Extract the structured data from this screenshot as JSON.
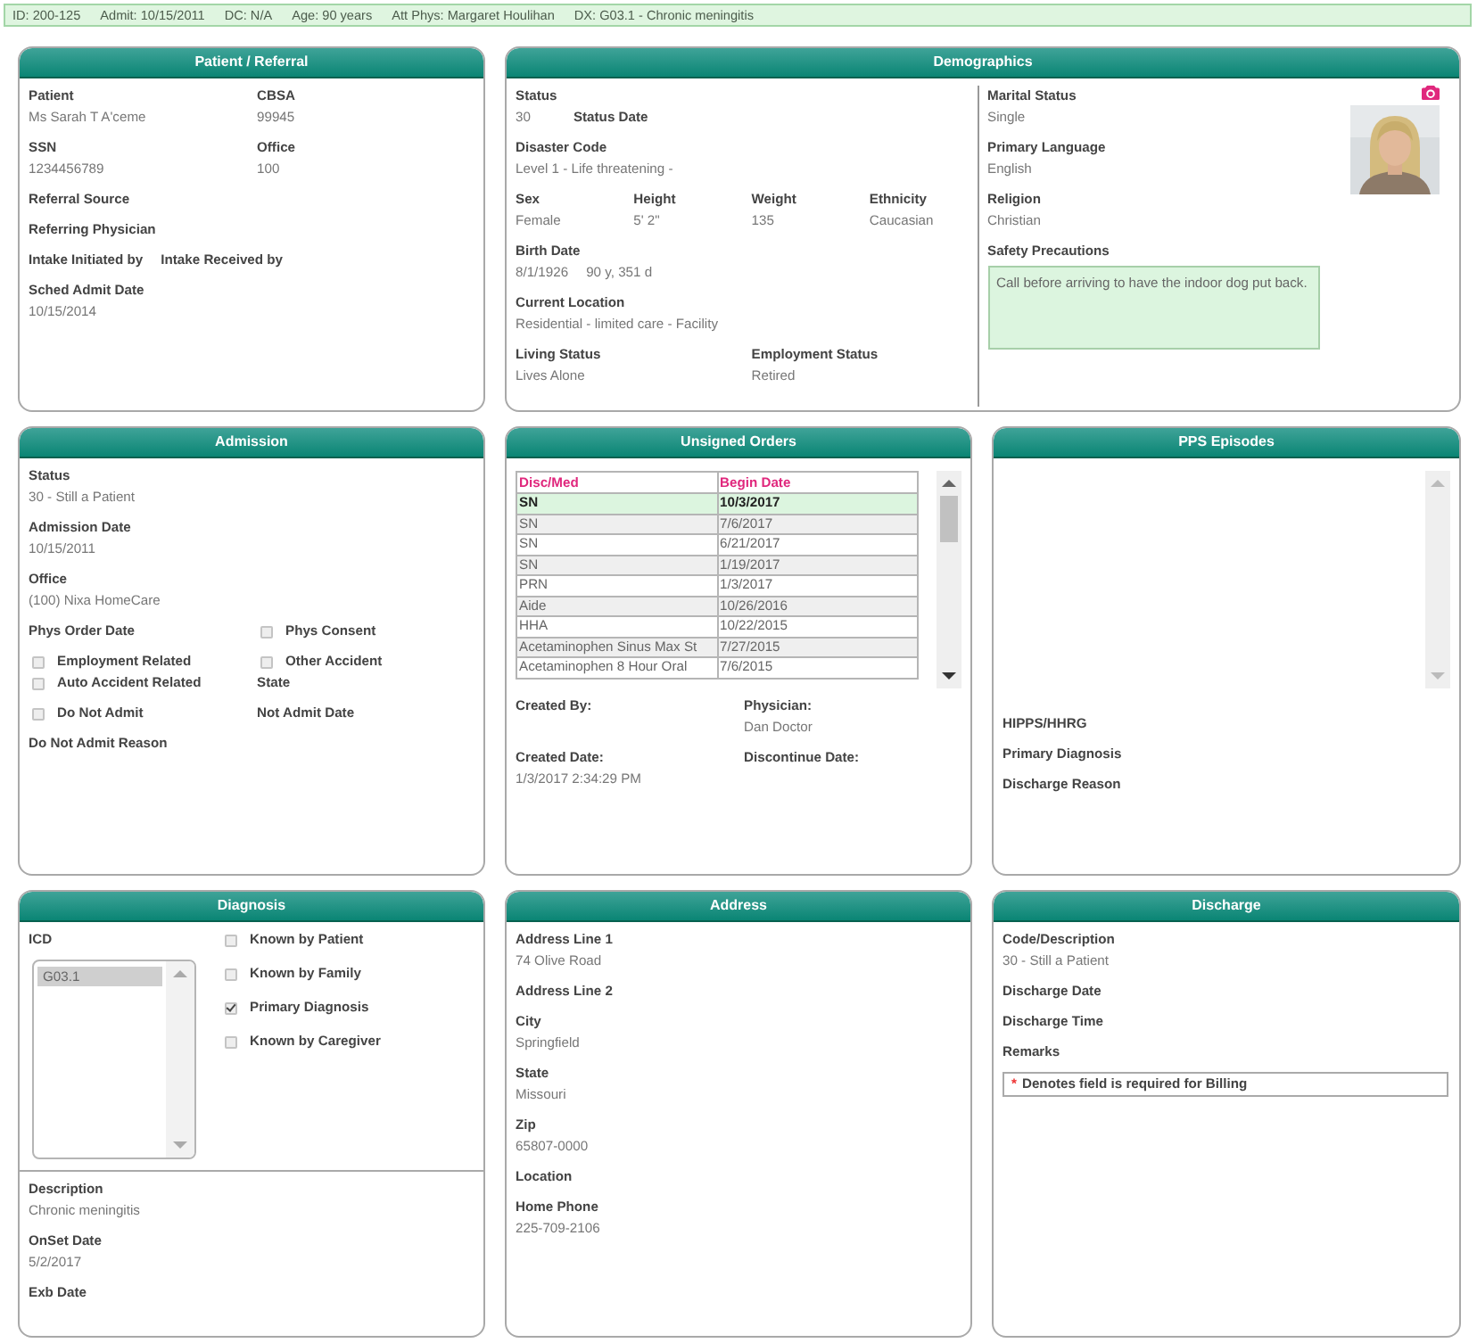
{
  "info_bar": {
    "items": [
      "ID: 200-125",
      "Admit: 10/15/2011",
      "DC: N/A",
      "Age: 90 years",
      "Att Phys: Margaret Houlihan",
      "DX: G03.1 - Chronic meningitis"
    ]
  },
  "panels": [
    {
      "kind": "standard",
      "title": "Patient / Referral",
      "sections": [
        {
          "kind": "rows",
          "rows": [
            {
              "kind": "grid",
              "cells": [
                {
                  "kind": "field",
                  "label": "Patient",
                  "value": "Ms Sarah T A'ceme"
                },
                {
                  "kind": "field",
                  "label": "CBSA",
                  "value": "99945"
                }
              ]
            },
            {
              "kind": "grid",
              "cells": [
                {
                  "kind": "field",
                  "label": "SSN",
                  "value": "1234456789"
                },
                {
                  "kind": "field",
                  "label": "Office",
                  "value": "100"
                }
              ]
            },
            {
              "kind": "grid",
              "cells": [
                {
                  "kind": "field",
                  "label": "Referral Source"
                }
              ]
            },
            {
              "kind": "grid",
              "cells": [
                {
                  "kind": "field",
                  "label": "Referring Physician"
                }
              ]
            },
            {
              "kind": "inline",
              "cells": [
                {
                  "kind": "field",
                  "label": "Intake Initiated by"
                },
                {
                  "kind": "field",
                  "label": "Intake Received by"
                }
              ]
            },
            {
              "kind": "grid",
              "cells": [
                {
                  "kind": "field",
                  "label": "Sched Admit Date",
                  "value": "10/15/2014"
                }
              ]
            }
          ]
        }
      ]
    },
    {
      "kind": "wide",
      "title": "Demographics",
      "sections": [
        {
          "kind": "columns",
          "left": [
            {
              "kind": "rows",
              "rows": [
                {
                  "kind": "grid",
                  "cells": [
                    {
                      "kind": "field",
                      "label": "Status",
                      "value": "30",
                      "side_label": "Status Date"
                    }
                  ]
                },
                {
                  "kind": "grid",
                  "cells": [
                    {
                      "kind": "field",
                      "label": "Disaster Code",
                      "value": "Level 1 - Life threatening -"
                    }
                  ]
                },
                {
                  "kind": "grid",
                  "cells": [
                    {
                      "kind": "field",
                      "label": "Sex",
                      "value": "Female"
                    },
                    {
                      "kind": "field",
                      "label": "Height",
                      "value": "5' 2\""
                    },
                    {
                      "kind": "field",
                      "label": "Weight",
                      "value": "135"
                    },
                    {
                      "kind": "field",
                      "label": "Ethnicity",
                      "value": "Caucasian"
                    }
                  ]
                },
                {
                  "kind": "grid",
                  "cells": [
                    {
                      "kind": "field",
                      "label": "Birth Date",
                      "value": "8/1/1926",
                      "extra": "90 y, 351 d"
                    }
                  ]
                },
                {
                  "kind": "grid",
                  "cells": [
                    {
                      "kind": "field",
                      "label": "Current Location",
                      "value": "Residential - limited care - Facility"
                    }
                  ]
                },
                {
                  "kind": "grid",
                  "cells": [
                    {
                      "kind": "field",
                      "label": "Living Status",
                      "value": "Lives Alone"
                    },
                    "",
                    {
                      "kind": "field",
                      "label": "Employment Status",
                      "value": "Retired"
                    },
                    ""
                  ]
                }
              ]
            }
          ],
          "right": [
            {
              "kind": "profile",
              "photo": {
                "kind": "picture"
              },
              "rows": [
                {
                  "kind": "grid",
                  "cells": [
                    {
                      "kind": "field",
                      "label": "Marital Status",
                      "value": "Single"
                    }
                  ]
                },
                {
                  "kind": "grid",
                  "cells": [
                    {
                      "kind": "field",
                      "label": "Primary Language",
                      "value": "English"
                    }
                  ]
                },
                {
                  "kind": "grid",
                  "cells": [
                    {
                      "kind": "field",
                      "label": "Religion",
                      "value": "Christian"
                    }
                  ]
                }
              ]
            },
            {
              "kind": "rows",
              "rows": [
                {
                  "kind": "grid",
                  "cells": [
                    {
                      "kind": "textarea",
                      "label": "Safety Precautions",
                      "value": "Call before arriving to have the indoor dog put back."
                    }
                  ]
                }
              ]
            }
          ]
        }
      ]
    },
    {
      "kind": "standard",
      "title": "Admission",
      "sections": [
        {
          "kind": "rows",
          "rows": [
            {
              "kind": "grid",
              "cells": [
                {
                  "kind": "field",
                  "label": "Status",
                  "value": "30 - Still a Patient"
                }
              ]
            },
            {
              "kind": "grid",
              "cells": [
                {
                  "kind": "field",
                  "label": "Admission Date",
                  "value": "10/15/2011"
                }
              ]
            },
            {
              "kind": "grid",
              "cells": [
                {
                  "kind": "field",
                  "label": "Office",
                  "value": "(100) Nixa HomeCare"
                }
              ]
            },
            {
              "kind": "grid",
              "cells": [
                {
                  "kind": "field",
                  "label": "Phys Order Date"
                },
                {
                  "kind": "check",
                  "label": "Phys Consent",
                  "checked": false
                }
              ]
            },
            {
              "kind": "tight",
              "cells": [
                {
                  "kind": "check",
                  "label": "Employment Related",
                  "checked": false
                },
                {
                  "kind": "check",
                  "label": "Other Accident",
                  "checked": false
                }
              ]
            },
            {
              "kind": "grid",
              "cells": [
                {
                  "kind": "check",
                  "label": "Auto Accident Related",
                  "checked": false
                },
                {
                  "kind": "field",
                  "label": "State"
                }
              ]
            },
            {
              "kind": "grid",
              "cells": [
                {
                  "kind": "check",
                  "label": "Do Not Admit",
                  "checked": false
                },
                {
                  "kind": "field",
                  "label": "Not Admit Date"
                }
              ]
            },
            {
              "kind": "grid",
              "cells": [
                {
                  "kind": "field",
                  "label": "Do Not Admit Reason"
                }
              ]
            }
          ]
        }
      ]
    },
    {
      "kind": "standard",
      "title": "Unsigned Orders",
      "sections": [
        {
          "kind": "table",
          "columns": [
            "Disc/Med",
            "Begin Date"
          ],
          "rows": [
            {
              "cells": [
                "SN",
                "10/3/2017"
              ],
              "selected": true
            },
            {
              "cells": [
                "SN",
                "7/6/2017"
              ],
              "selected": false
            },
            {
              "cells": [
                "SN",
                "6/21/2017"
              ],
              "selected": false
            },
            {
              "cells": [
                "SN",
                "1/19/2017"
              ],
              "selected": false
            },
            {
              "cells": [
                "PRN",
                "1/3/2017"
              ],
              "selected": false
            },
            {
              "cells": [
                "Aide",
                "10/26/2016"
              ],
              "selected": false
            },
            {
              "cells": [
                "HHA",
                "10/22/2015"
              ],
              "selected": false
            },
            {
              "cells": [
                "Acetaminophen Sinus Max St",
                "7/27/2015"
              ],
              "selected": false
            },
            {
              "cells": [
                "Acetaminophen 8 Hour Oral",
                "7/6/2015"
              ],
              "selected": false
            }
          ]
        },
        {
          "kind": "rows",
          "rows": [
            {
              "kind": "grid",
              "cells": [
                {
                  "kind": "field",
                  "label": "Created By:"
                },
                {
                  "kind": "field",
                  "label": "Physician:",
                  "value": "Dan Doctor"
                }
              ]
            },
            {
              "kind": "grid",
              "cells": [
                {
                  "kind": "field",
                  "label": "Created Date:",
                  "value": "1/3/2017 2:34:29 PM"
                },
                {
                  "kind": "field",
                  "label": "Discontinue Date:"
                }
              ]
            }
          ]
        }
      ]
    },
    {
      "kind": "standard",
      "title": "PPS Episodes",
      "sections": [
        {
          "kind": "scroll-area"
        },
        {
          "kind": "rows",
          "rows": [
            {
              "kind": "grid",
              "cells": [
                {
                  "kind": "field",
                  "label": "HIPPS/HHRG"
                }
              ]
            },
            {
              "kind": "grid",
              "cells": [
                {
                  "kind": "field",
                  "label": "Primary Diagnosis"
                }
              ]
            },
            {
              "kind": "grid",
              "cells": [
                {
                  "kind": "field",
                  "label": "Discharge Reason"
                }
              ]
            }
          ]
        }
      ]
    },
    {
      "kind": "standard",
      "title": "Diagnosis",
      "sections": [
        {
          "kind": "split",
          "left": [
            {
              "kind": "rows",
              "rows": [
                {
                  "kind": "grid",
                  "cells": [
                    {
                      "kind": "field",
                      "label": "ICD"
                    }
                  ]
                }
              ]
            },
            {
              "kind": "listbox",
              "items": [
                {
                  "text": "G03.1",
                  "selected": true
                }
              ]
            }
          ],
          "right": [
            {
              "kind": "rows",
              "rows": [
                {
                  "kind": "spaced",
                  "cells": [
                    {
                      "kind": "check",
                      "label": "Known by Patient",
                      "checked": false
                    }
                  ]
                },
                {
                  "kind": "spaced",
                  "cells": [
                    {
                      "kind": "check",
                      "label": "Known by Family",
                      "checked": false
                    }
                  ]
                },
                {
                  "kind": "spaced",
                  "cells": [
                    {
                      "kind": "check",
                      "label": "Primary Diagnosis",
                      "checked": true
                    }
                  ]
                },
                {
                  "kind": "spaced",
                  "cells": [
                    {
                      "kind": "check",
                      "label": "Known by Caregiver",
                      "checked": false
                    }
                  ]
                }
              ]
            }
          ]
        },
        {
          "kind": "divider"
        },
        {
          "kind": "rows",
          "rows": [
            {
              "kind": "grid",
              "cells": [
                {
                  "kind": "field",
                  "label": "Description",
                  "value": "Chronic meningitis"
                }
              ]
            },
            {
              "kind": "grid",
              "cells": [
                {
                  "kind": "field",
                  "label": "OnSet Date",
                  "value": "5/2/2017"
                }
              ]
            },
            {
              "kind": "grid",
              "cells": [
                {
                  "kind": "field",
                  "label": "Exb Date"
                }
              ]
            }
          ]
        }
      ]
    },
    {
      "kind": "standard",
      "title": "Address",
      "sections": [
        {
          "kind": "rows",
          "rows": [
            {
              "kind": "grid",
              "cells": [
                {
                  "kind": "field",
                  "label": "Address Line 1",
                  "value": "74 Olive Road"
                }
              ]
            },
            {
              "kind": "grid",
              "cells": [
                {
                  "kind": "field",
                  "label": "Address Line 2"
                }
              ]
            },
            {
              "kind": "grid",
              "cells": [
                {
                  "kind": "field",
                  "label": "City",
                  "value": "Springfield"
                }
              ]
            },
            {
              "kind": "grid",
              "cells": [
                {
                  "kind": "field",
                  "label": "State",
                  "value": "Missouri"
                }
              ]
            },
            {
              "kind": "grid",
              "cells": [
                {
                  "kind": "field",
                  "label": "Zip",
                  "value": "65807-0000"
                }
              ]
            },
            {
              "kind": "grid",
              "cells": [
                {
                  "kind": "field",
                  "label": "Location"
                }
              ]
            },
            {
              "kind": "grid",
              "cells": [
                {
                  "kind": "field",
                  "label": "Home Phone",
                  "value": "225-709-2106"
                }
              ]
            }
          ]
        }
      ]
    },
    {
      "kind": "standard",
      "title": "Discharge",
      "sections": [
        {
          "kind": "rows",
          "rows": [
            {
              "kind": "grid",
              "cells": [
                {
                  "kind": "field",
                  "label": "Code/Description",
                  "value": "30 - Still a Patient"
                }
              ]
            },
            {
              "kind": "grid",
              "cells": [
                {
                  "kind": "field",
                  "label": "Discharge Date"
                }
              ]
            },
            {
              "kind": "grid",
              "cells": [
                {
                  "kind": "field",
                  "label": "Discharge Time"
                }
              ]
            },
            {
              "kind": "grid",
              "cells": [
                {
                  "kind": "field",
                  "label": "Remarks"
                }
              ]
            }
          ]
        },
        {
          "kind": "note",
          "mark": "*",
          "text": "Denotes field is required for Billing"
        }
      ]
    }
  ]
}
